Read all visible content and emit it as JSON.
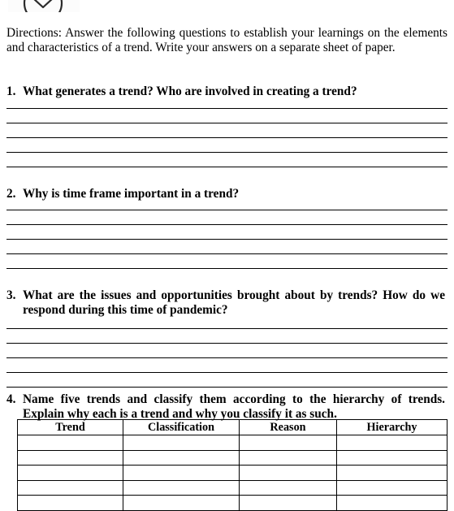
{
  "document": {
    "header_icon": "circle-check-badge-icon",
    "directions_label": "Directions:",
    "directions_text": "Directions: Answer the following questions to establish your learnings on the elements and characteristics of a trend. Write your answers on a separate sheet of paper."
  },
  "questions": [
    {
      "number": "1.",
      "text": "What generates a trend? Who are involved in creating a trend?",
      "answer_lines": 5
    },
    {
      "number": "2.",
      "text": "Why is time frame important in a trend?",
      "answer_lines": 5
    },
    {
      "number": "3.",
      "text": "What are the issues and opportunities brought about by trends? How do we respond during this time of pandemic?",
      "answer_lines": 5
    },
    {
      "number": "4.",
      "text": "Name five trends and classify them according to the hierarchy of trends. Explain why each is a trend and why you classify it as such.",
      "answer_lines": 0
    }
  ],
  "table": {
    "headers": [
      "Trend",
      "Classification",
      "Reason",
      "Hierarchy"
    ],
    "rows": [
      [
        "",
        "",
        "",
        ""
      ],
      [
        "",
        "",
        "",
        ""
      ],
      [
        "",
        "",
        "",
        ""
      ],
      [
        "",
        "",
        "",
        ""
      ],
      [
        "",
        "",
        "",
        ""
      ]
    ]
  },
  "colors": {
    "text": "#000000",
    "page_background": "#ffffff",
    "rule": "#000000",
    "icon_strip_background": "#fcfcfc"
  }
}
